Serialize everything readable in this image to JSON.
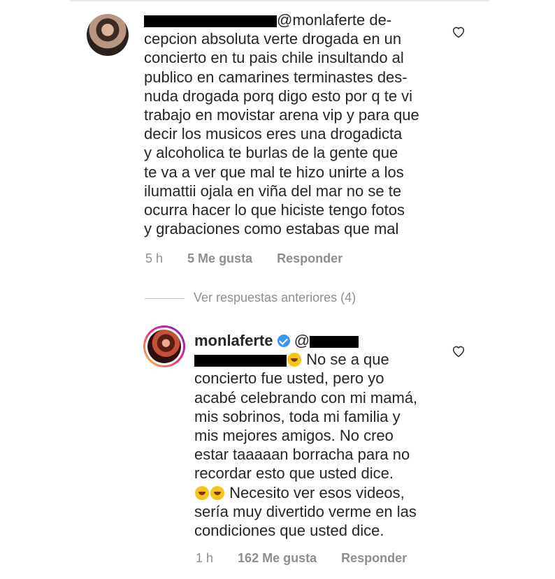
{
  "comment1": {
    "mention": "@monlaferte",
    "body": " de-\ncepcion absoluta verte drogada en un\nconcierto en tu pais chile insultando al\npublico en camarines terminastes des-\nnuda drogada porq digo esto por q te vi\ntrabajo en movistar arena vip y para que\ndecir los musicos eres una drogadicta\ny alcoholica te burlas de la gente que\nte va a ver que mal te hizo unirte a los\nilumattii ojala en viña del mar no se te\nocurra hacer lo que hiciste tengo fotos\ny grabaciones como estabas que mal",
    "time": "5 h",
    "likes": "5 Me gusta",
    "reply": "Responder",
    "heart_icon": "heart-outline-icon"
  },
  "view_more": "Ver respuestas anteriores (4)",
  "comment2": {
    "username": "monlaferte",
    "mention_prefix": "@",
    "body_1": " No se a que\nconcierto fue usted, pero yo\nacabé celebrando con mi mamá,\nmis sobrinos, toda mi familia y\nmis mejores amigos. No creo\nestar taaaaan borracha para no\nrecordar esto que usted dice.\n",
    "body_2": " Necesito ver esos videos,\nsería muy divertido verme en las\ncondiciones que usted dice.",
    "time": "1 h",
    "likes": "162 Me gusta",
    "reply": "Responder",
    "verified_icon": "verified-badge-icon",
    "heart_icon": "heart-outline-icon"
  },
  "colors": {
    "text": "#262626",
    "muted": "#8e8e8e",
    "verified": "#3897f0"
  }
}
